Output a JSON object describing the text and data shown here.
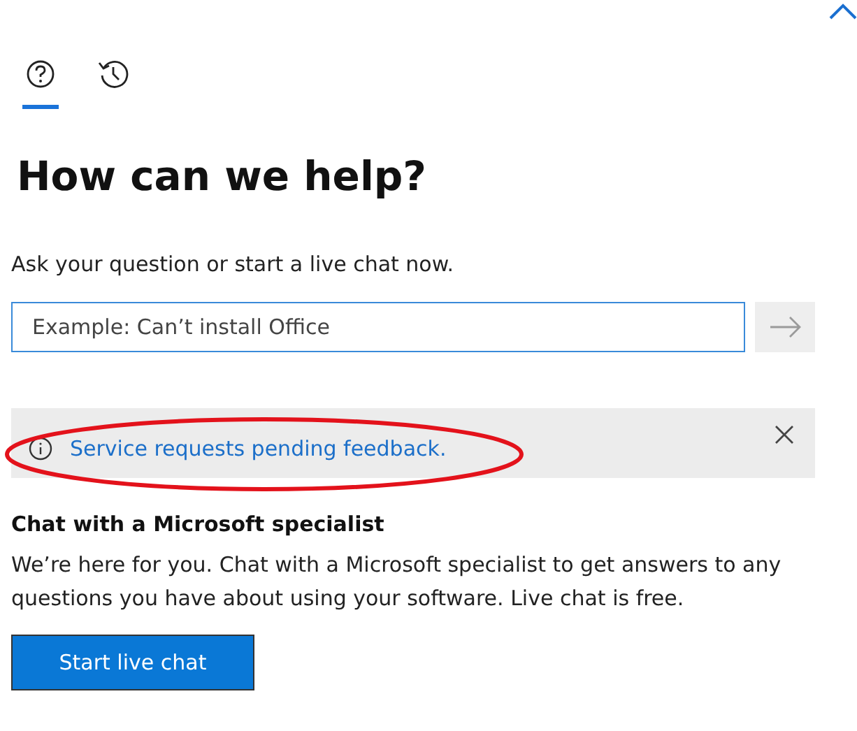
{
  "tabs": [
    {
      "kind": "help",
      "selected": true
    },
    {
      "kind": "history",
      "selected": false
    }
  ],
  "heading": "How can we help?",
  "prompt": "Ask your question or start a live chat now.",
  "search": {
    "placeholder": "Example: Can’t install Office"
  },
  "notice": {
    "text": "Service requests pending feedback.",
    "highlighted": true
  },
  "chat": {
    "title": "Chat with a Microsoft specialist",
    "body": "We’re here for you. Chat with a Microsoft specialist to get answers to any questions you have about using your software. Live chat is free.",
    "button": "Start live chat"
  }
}
